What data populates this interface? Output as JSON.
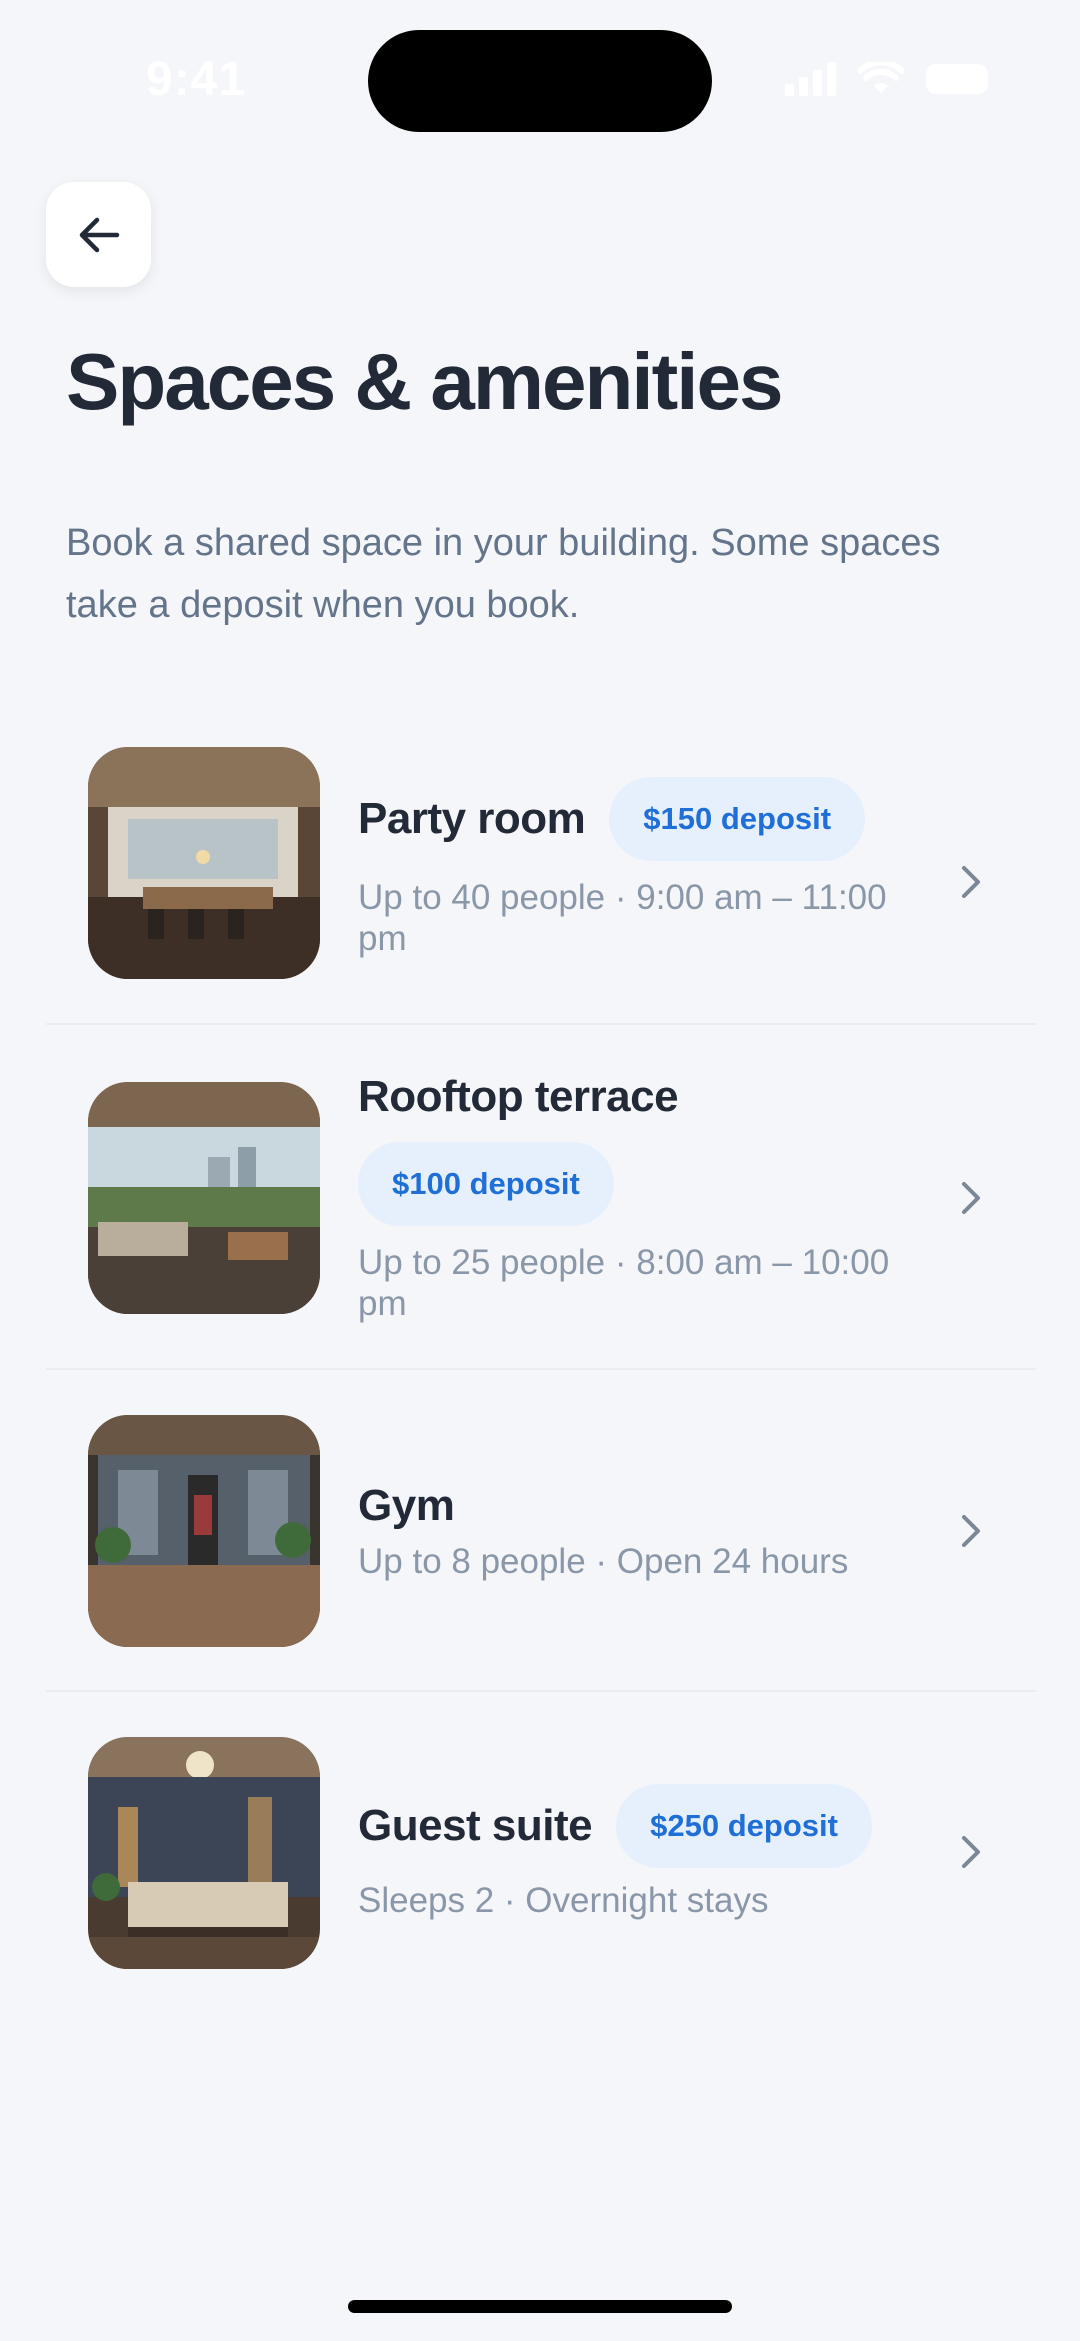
{
  "status_bar": {
    "time": "9:41"
  },
  "header": {
    "back_icon": "arrow-left-icon",
    "title": "Spaces & amenities",
    "subtitle": "Book a shared space in your building. Some spaces take a deposit when you book."
  },
  "spaces": [
    {
      "name": "Party room",
      "deposit": "$150 deposit",
      "details": "Up to 40 people · 9:00 am – 11:00 pm"
    },
    {
      "name": "Rooftop terrace",
      "deposit": "$100 deposit",
      "details": "Up to 25 people · 8:00 am – 10:00 pm"
    },
    {
      "name": "Gym",
      "deposit": "",
      "details": "Up to 8 people · Open 24 hours"
    },
    {
      "name": "Guest suite",
      "deposit": "$250 deposit",
      "details": "Sleeps 2 · Overnight stays"
    }
  ],
  "colors": {
    "background": "#f4f6f9",
    "title": "#222a38",
    "muted": "#8a97a8",
    "badge_bg": "#e6f0fd",
    "badge_text": "#1f6fd6"
  }
}
